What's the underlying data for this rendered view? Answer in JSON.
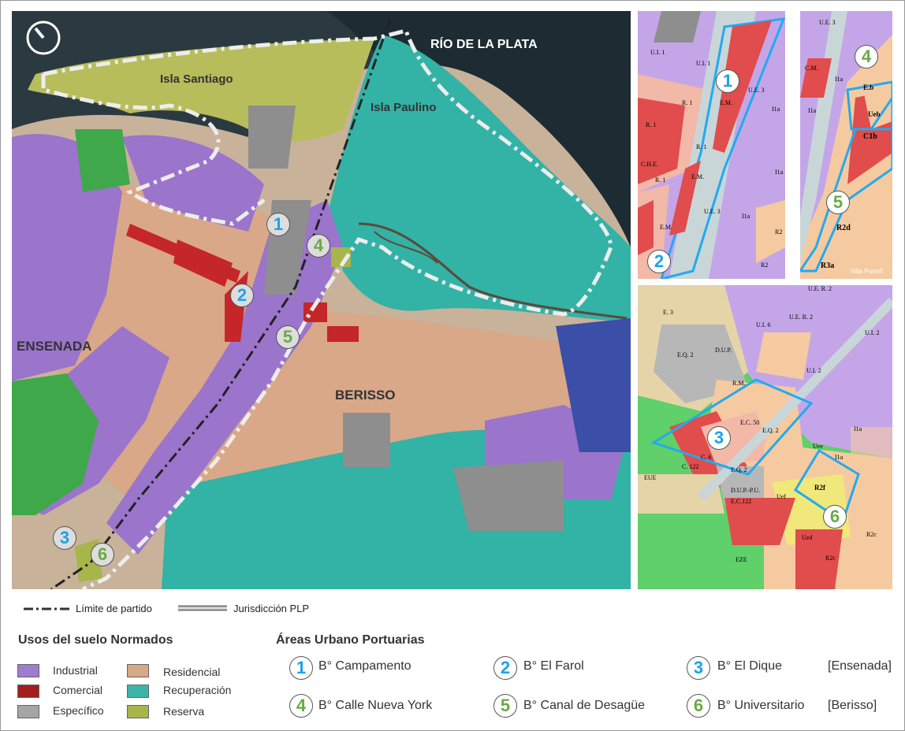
{
  "main_map": {
    "labels": {
      "river": "RÍO DE LA PLATA",
      "isla_santiago": "Isla Santiago",
      "isla_paulino": "Isla Paulino",
      "ensenada": "ENSENADA",
      "berisso": "BERISSO"
    },
    "markers": [
      "1",
      "2",
      "3",
      "4",
      "5",
      "6"
    ]
  },
  "inset_a": {
    "zones": [
      "U.I. 1",
      "U.I. 1",
      "U.E. 3",
      "R. 1",
      "R. 1",
      "R. 1",
      "C.H.E.",
      "R. 1",
      "E.M.",
      "E.M.",
      "E.M.",
      "U.E. 3",
      "I1a",
      "I1a",
      "I1a",
      "R2",
      "R2"
    ],
    "markers": [
      "1",
      "2"
    ]
  },
  "inset_b": {
    "zones": [
      "U.E. 3",
      "C.M.",
      "I1a",
      "I1a",
      "E.b",
      "Ueb",
      "C1b",
      "R2d",
      "R3a",
      "Villa Porteñ"
    ],
    "markers": [
      "4",
      "5"
    ]
  },
  "inset_c": {
    "zones": [
      "E. 3",
      "U.E. R. 2",
      "U.E. R. 2",
      "U.I. 6",
      "U.I. 2",
      "U.I. 2",
      "E.Q. 2",
      "D.U.P.",
      "R.M.",
      "E.C. 50",
      "E.Q. 2",
      "E.Q. 2",
      "C. 6",
      "C. 122",
      "I1a",
      "I1a",
      "Uee",
      "R2f",
      "R2c",
      "R2c",
      "Ued",
      "Uef",
      "E.C.122",
      "D.U.P.-P.U.",
      "EUE",
      "EZE"
    ],
    "markers": [
      "3",
      "6"
    ]
  },
  "line_legend": {
    "limite": "Límite de partido",
    "jurisdiccion": "Jurisdicción PLP"
  },
  "usos": {
    "title": "Usos del suelo Normados",
    "items": [
      {
        "label": "Industrial",
        "color": "#a07cd0"
      },
      {
        "label": "Comercial",
        "color": "#a31e1e"
      },
      {
        "label": "Específico",
        "color": "#a5a5a5"
      },
      {
        "label": "Residencial",
        "color": "#d9a888"
      },
      {
        "label": "Recuperación",
        "color": "#3bb5aa"
      },
      {
        "label": "Reserva",
        "color": "#a7b54a"
      }
    ]
  },
  "areas": {
    "title": "Áreas Urbano Portuarias",
    "items": [
      {
        "num": "1",
        "label": "B° Campamento",
        "color": "#1aa3e8"
      },
      {
        "num": "2",
        "label": "B° El Farol",
        "color": "#1aa3e8"
      },
      {
        "num": "3",
        "label": "B° El Dique",
        "color": "#1aa3e8"
      },
      {
        "num": "4",
        "label": "B° Calle Nueva York",
        "color": "#6aaa45"
      },
      {
        "num": "5",
        "label": "B° Canal de Desagüe",
        "color": "#6aaa45"
      },
      {
        "num": "6",
        "label": "B° Universitario",
        "color": "#6aaa45"
      }
    ],
    "groups": [
      "[Ensenada]",
      "[Berisso]"
    ]
  }
}
